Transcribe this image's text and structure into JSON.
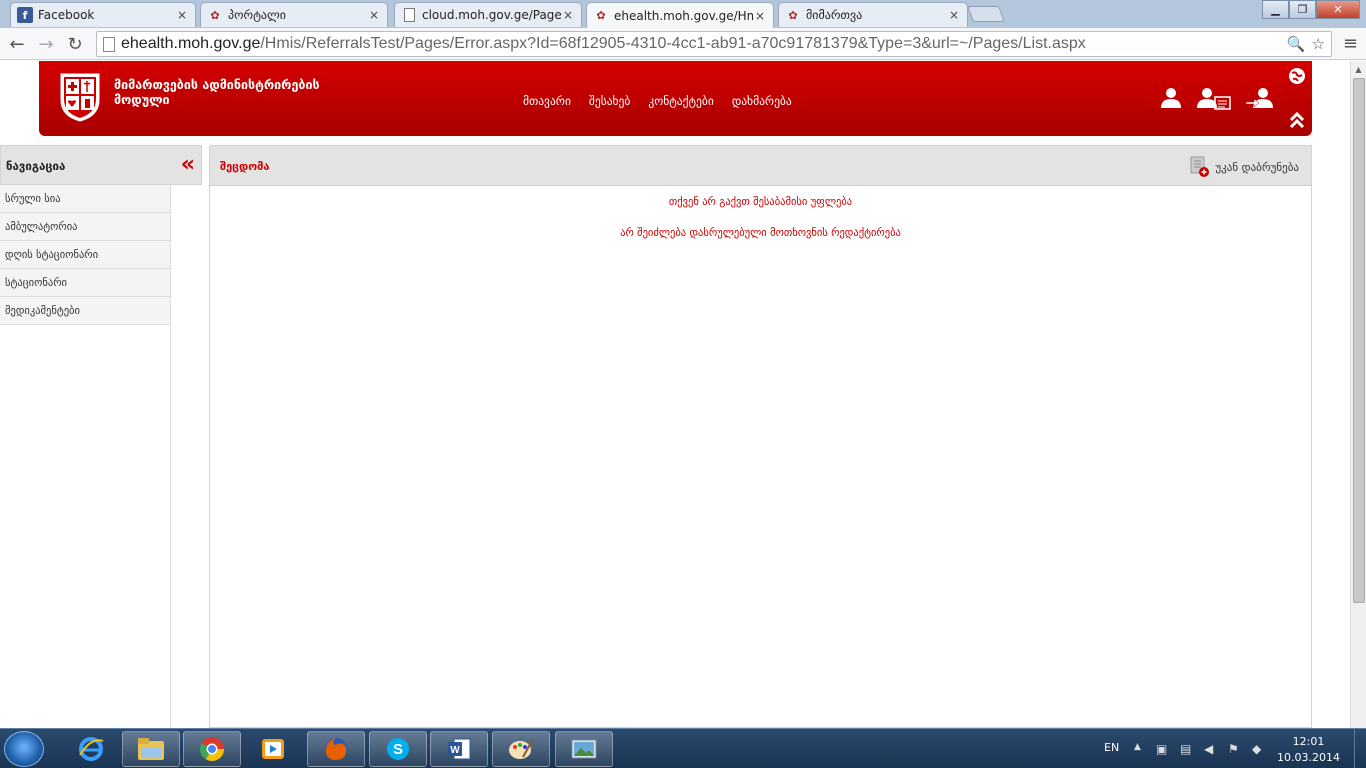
{
  "browser": {
    "tabs": [
      {
        "title": "Facebook",
        "icon": "facebook-icon"
      },
      {
        "title": "პორტალი",
        "icon": "seal-icon"
      },
      {
        "title": "cloud.moh.gov.ge/Pages/",
        "icon": "page-icon"
      },
      {
        "title": "ehealth.moh.gov.ge/Hmis",
        "icon": "seal-icon",
        "active": true
      },
      {
        "title": "მიმართვა",
        "icon": "seal-icon"
      }
    ],
    "close_glyph": "×",
    "url_host": "ehealth.moh.gov.ge",
    "url_path": "/Hmis/ReferralsTest/Pages/Error.aspx?Id=68f12905-4310-4cc1-ab91-a70c91781379&Type=3&url=~/Pages/List.aspx"
  },
  "header": {
    "title": "მიმართვების ადმინისტრირების მოდული",
    "nav": [
      "მთავარი",
      "შესახებ",
      "კონტაქტები",
      "დახმარება"
    ],
    "brand_color": "#cc0000"
  },
  "navigation": {
    "title": "ნავიგაცია",
    "items": [
      "სრული სია",
      "ამბულატორია",
      "დღის სტაციონარი",
      "სტაციონარი",
      "მედიკამენტები"
    ]
  },
  "content": {
    "title": "შეცდომა",
    "back_label": "უკან დაბრუნება",
    "messages": [
      "თქვენ არ გაქვთ შესაბამისი უფლება",
      "არ შეიძლება დასრულებული მოთხოვნის რედაქტირება"
    ]
  },
  "taskbar": {
    "apps": [
      "ie-icon",
      "explorer-icon",
      "chrome-icon",
      "media-player-icon",
      "firefox-icon",
      "skype-icon",
      "word-icon",
      "paint-icon",
      "photo-viewer-icon"
    ],
    "language": "EN",
    "time": "12:01",
    "date": "10.03.2014"
  }
}
